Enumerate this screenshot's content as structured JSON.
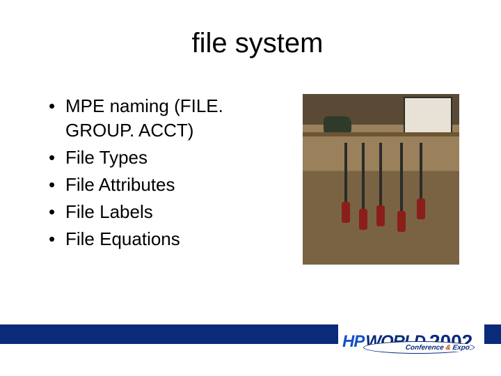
{
  "title": "file system",
  "bullets": [
    "MPE naming (FILE. GROUP. ACCT)",
    "File Types",
    "File Attributes",
    "File Labels",
    "File Equations"
  ],
  "image": {
    "alt": "workbench-tools-photo"
  },
  "footer": {
    "logo_hp": "HP",
    "logo_world": "WORLD",
    "logo_year": "2002",
    "logo_sub_left": "Conference",
    "logo_sub_amp": "&",
    "logo_sub_right": "Expo"
  }
}
